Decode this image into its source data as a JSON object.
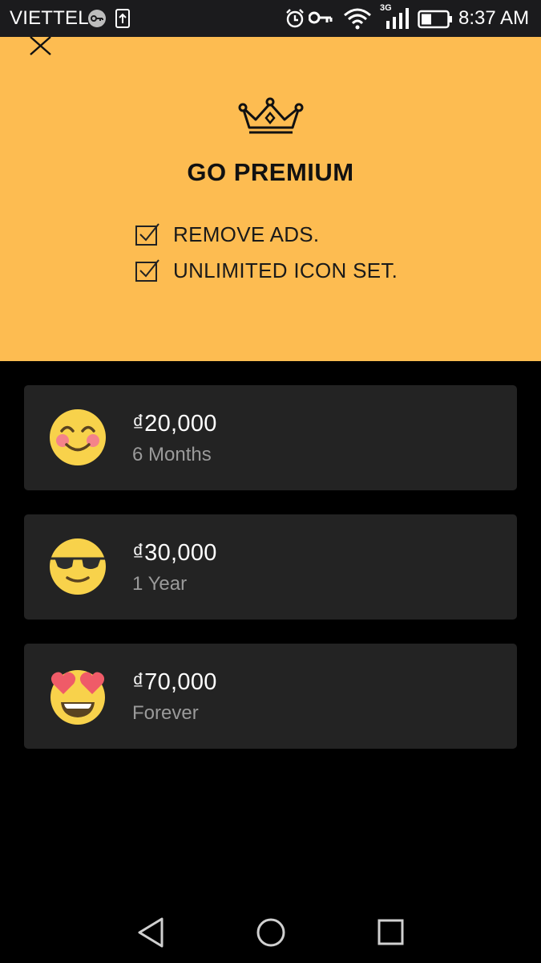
{
  "status_bar": {
    "carrier": "VIETTEL",
    "network_type": "3G",
    "time": "8:37 AM",
    "icons": [
      "vpn-key-icon",
      "upload-icon",
      "alarm-icon",
      "key-icon",
      "wifi-icon",
      "signal-icon",
      "battery-icon"
    ],
    "battery_level": 0.35
  },
  "premium": {
    "title": "GO PREMIUM",
    "background_color": "#fdbc51",
    "features": [
      {
        "label": "REMOVE ADS.",
        "icon": "checkbox-checked-icon"
      },
      {
        "label": "UNLIMITED ICON SET.",
        "icon": "checkbox-checked-icon"
      }
    ],
    "icons": [
      "close-icon",
      "crown-icon"
    ]
  },
  "plans": [
    {
      "price": "₫20,000",
      "period": "6 Months",
      "icon": "smiling-blush-emoji"
    },
    {
      "price": "₫30,000",
      "period": "1 Year",
      "icon": "sunglasses-emoji"
    },
    {
      "price": "₫70,000",
      "period": "Forever",
      "icon": "heart-eyes-emoji"
    }
  ],
  "nav_bar": {
    "icons": [
      "back-icon",
      "home-icon",
      "recents-icon"
    ]
  }
}
